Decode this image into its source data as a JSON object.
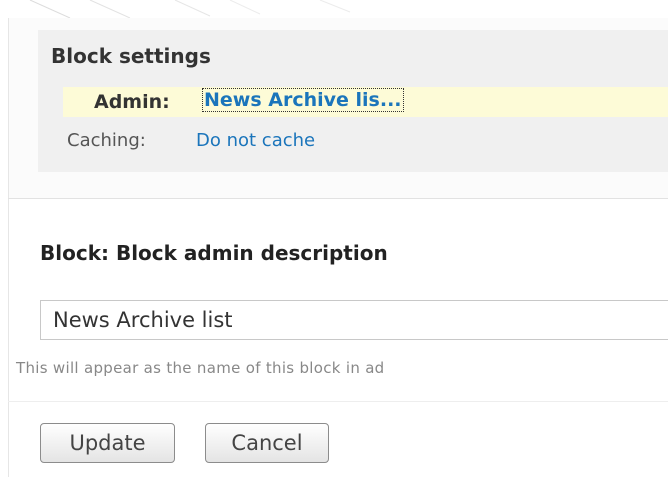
{
  "block_settings": {
    "title": "Block settings",
    "admin_label": "Admin:",
    "admin_value": "News Archive lis...",
    "caching_label": "Caching:",
    "caching_value": "Do not cache"
  },
  "field": {
    "label": "Block: Block admin description",
    "value": "News Archive list",
    "help": "This will appear as the name of this block in ad"
  },
  "actions": {
    "update_label": "Update",
    "cancel_label": "Cancel"
  },
  "colors": {
    "link": "#1b75bb",
    "admin_highlight": "#fdfbd7",
    "settings_background": "#f0f0f0"
  }
}
